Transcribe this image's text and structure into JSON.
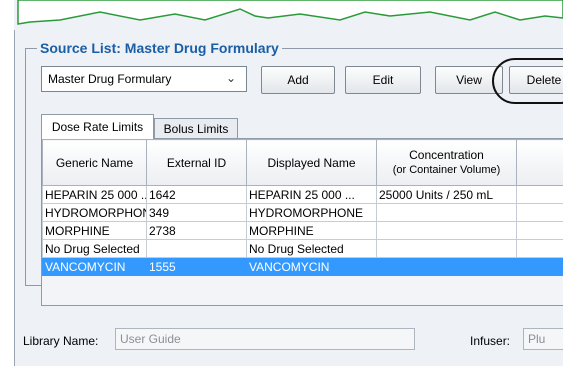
{
  "source_list": {
    "title": "Source List: Master Drug Formulary",
    "selected_list": "Master Drug Formulary",
    "buttons": {
      "add": "Add",
      "edit": "Edit",
      "view": "View",
      "delete": "Delete"
    }
  },
  "tabs": [
    {
      "label": "Dose Rate Limits",
      "active": true
    },
    {
      "label": "Bolus Limits",
      "active": false
    }
  ],
  "table": {
    "headers": [
      {
        "line1": "Generic Name",
        "line2": ""
      },
      {
        "line1": "External ID",
        "line2": ""
      },
      {
        "line1": "Displayed Name",
        "line2": ""
      },
      {
        "line1": "Concentration",
        "line2": "(or Container Volume)"
      },
      {
        "line1": "",
        "line2": ""
      }
    ],
    "rows": [
      [
        "HEPARIN 25 000 ...",
        "1642",
        "HEPARIN 25 000 ...",
        "25000 Units / 250 mL",
        ""
      ],
      [
        "HYDROMORPHONE",
        "349",
        "HYDROMORPHONE",
        "",
        ""
      ],
      [
        "MORPHINE",
        "2738",
        "MORPHINE",
        "",
        ""
      ],
      [
        "No Drug Selected",
        "",
        "No Drug Selected",
        "",
        ""
      ],
      [
        "VANCOMYCIN",
        "1555",
        "VANCOMYCIN",
        "",
        ""
      ]
    ],
    "selected_row": 4
  },
  "footer": {
    "library_label": "Library Name:",
    "library_value": "User Guide",
    "infuser_label": "Infuser:",
    "infuser_value": "Plu"
  },
  "colors": {
    "section_title": "#1a5ea6",
    "selection": "#3399ff",
    "panel_bg": "#eef1f6"
  }
}
